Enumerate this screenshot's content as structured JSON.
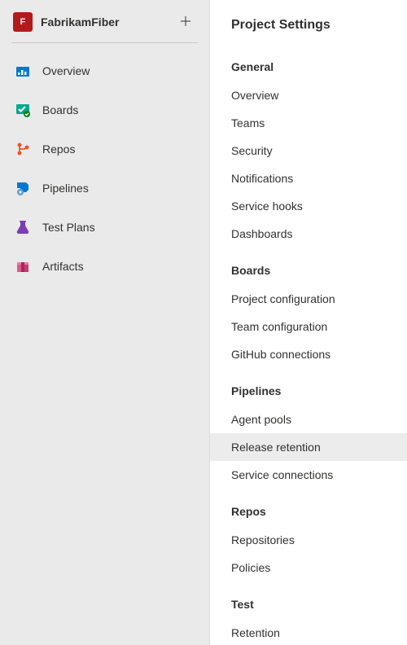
{
  "project": {
    "logo_letter": "F",
    "name": "FabrikamFiber"
  },
  "nav": {
    "items": [
      {
        "label": "Overview",
        "icon": "overview"
      },
      {
        "label": "Boards",
        "icon": "boards"
      },
      {
        "label": "Repos",
        "icon": "repos"
      },
      {
        "label": "Pipelines",
        "icon": "pipelines"
      },
      {
        "label": "Test Plans",
        "icon": "test-plans"
      },
      {
        "label": "Artifacts",
        "icon": "artifacts"
      }
    ]
  },
  "settings": {
    "title": "Project Settings",
    "sections": [
      {
        "heading": "General",
        "items": [
          "Overview",
          "Teams",
          "Security",
          "Notifications",
          "Service hooks",
          "Dashboards"
        ]
      },
      {
        "heading": "Boards",
        "items": [
          "Project configuration",
          "Team configuration",
          "GitHub connections"
        ]
      },
      {
        "heading": "Pipelines",
        "items": [
          "Agent pools",
          "Release retention",
          "Service connections"
        ]
      },
      {
        "heading": "Repos",
        "items": [
          "Repositories",
          "Policies"
        ]
      },
      {
        "heading": "Test",
        "items": [
          "Retention"
        ]
      }
    ],
    "hovered": "Release retention"
  }
}
